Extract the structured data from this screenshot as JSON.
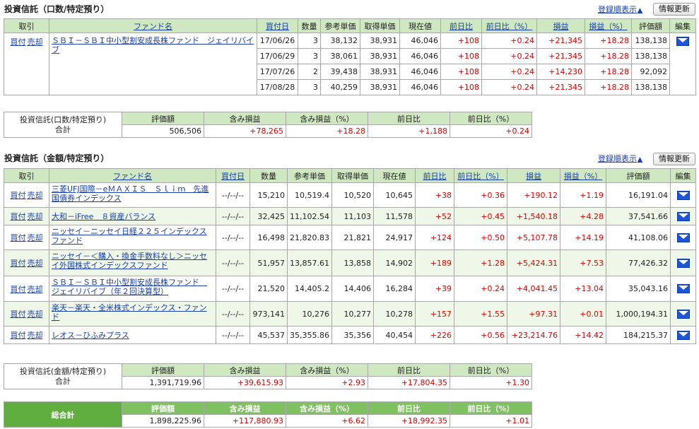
{
  "s1": {
    "title": "投資信託（口数/特定預り）",
    "sort_link": "登録順表示",
    "refresh": "情報更新",
    "headers": [
      "取引",
      "ファンド名",
      "買付日",
      "数量",
      "参考単価",
      "取得単価",
      "現在値",
      "前日比",
      "前日比（%）",
      "損益",
      "損益（%）",
      "評価額",
      "編集"
    ],
    "buy": "買付",
    "sell": "売却",
    "fund": "ＳＢＩ－ＳＢＩ中小型割安成長株ファンド　ジェイリバイブ",
    "rows": [
      [
        "17/06/26",
        "3",
        "38,132",
        "38,931",
        "46,046",
        "+108",
        "+0.24",
        "+21,345",
        "+18.28",
        "138,138"
      ],
      [
        "17/06/29",
        "3",
        "38,061",
        "38,931",
        "46,046",
        "+108",
        "+0.24",
        "+21,345",
        "+18.28",
        "138,138"
      ],
      [
        "17/07/26",
        "2",
        "39,438",
        "38,931",
        "46,046",
        "+108",
        "+0.24",
        "+14,230",
        "+18.28",
        "92,092"
      ],
      [
        "17/08/28",
        "3",
        "40,259",
        "38,931",
        "46,046",
        "+108",
        "+0.24",
        "+21,345",
        "+18.28",
        "138,138"
      ]
    ]
  },
  "sum1": {
    "label1": "投資信託(口数/特定預り)",
    "label2": "合計",
    "headers": [
      "評価額",
      "含み損益",
      "含み損益（%）",
      "前日比",
      "前日比（%）"
    ],
    "values": [
      "506,506",
      "+78,265",
      "+18.28",
      "+1,188",
      "+0.24"
    ]
  },
  "s2": {
    "title": "投資信託（金額/特定預り）",
    "sort_link": "登録順表示",
    "refresh": "情報更新",
    "headers": [
      "取引",
      "ファンド名",
      "買付日",
      "数量",
      "参考単価",
      "取得単価",
      "現在値",
      "前日比",
      "前日比（%）",
      "損益",
      "損益（%）",
      "評価額",
      "編集"
    ],
    "buy": "買付",
    "sell": "売却",
    "rows": [
      [
        "三菱UFJ国際－eＭＡＸＩＳ　Ｓｌｉｍ　先進国債券インデックス",
        "--/--/--",
        "15,210",
        "10,519.4",
        "10,520",
        "10,645",
        "+38",
        "+0.36",
        "+190.12",
        "+1.19",
        "16,191.04"
      ],
      [
        "大和－iFree　８資産バランス",
        "--/--/--",
        "32,425",
        "11,102.54",
        "11,103",
        "11,578",
        "+52",
        "+0.45",
        "+1,540.18",
        "+4.28",
        "37,541.66"
      ],
      [
        "ニッセイ－ニッセイ日経２２５インデックスファンド",
        "--/--/--",
        "16,498",
        "21,820.83",
        "21,821",
        "24,917",
        "+124",
        "+0.50",
        "+5,107.78",
        "+14.19",
        "41,108.06"
      ],
      [
        "ニッセイ－＜購入・換金手数料なし＞ニッセイ外国株式インデックスファンド",
        "--/--/--",
        "51,957",
        "13,857.61",
        "13,858",
        "14,902",
        "+189",
        "+1.28",
        "+5,424.31",
        "+7.53",
        "77,426.32"
      ],
      [
        "ＳＢＩ－ＳＢＩ中小型割安成長株ファンド　ジェイリバイブ（年２回決算型）",
        "--/--/--",
        "21,520",
        "14,405.2",
        "14,406",
        "16,284",
        "+39",
        "+0.24",
        "+4,041.45",
        "+13.04",
        "35,043.16"
      ],
      [
        "楽天－楽天・全米株式インデックス・ファンド",
        "--/--/--",
        "973,141",
        "10,276",
        "10,277",
        "10,278",
        "+157",
        "+1.55",
        "+97.31",
        "+0.01",
        "1,000,194.31"
      ],
      [
        "レオス－ひふみプラス",
        "--/--/--",
        "45,537",
        "35,355.86",
        "35,356",
        "40,454",
        "+226",
        "+0.56",
        "+23,214.76",
        "+14.42",
        "184,215.37"
      ]
    ]
  },
  "sum2": {
    "label1": "投資信託(金額/特定預り)",
    "label2": "合計",
    "headers": [
      "評価額",
      "含み損益",
      "含み損益（%）",
      "前日比",
      "前日比（%）"
    ],
    "values": [
      "1,391,719.96",
      "+39,615.93",
      "+2.93",
      "+17,804.35",
      "+1.30"
    ]
  },
  "total": {
    "label": "総合計",
    "headers": [
      "評価額",
      "含み損益",
      "含み損益（%）",
      "前日比",
      "前日比（%）"
    ],
    "values": [
      "1,898,225.96",
      "+117,880.93",
      "+6.62",
      "+18,992.35",
      "+1.01"
    ]
  },
  "icons": {
    "triangle": "▲",
    "mail": "mail-icon"
  },
  "colors": {
    "header_bg": "#cfe8c1",
    "alt_row": "#eef7e8",
    "positive": "#e00000",
    "total_bg": "#5fae3f",
    "link": "#1a3fa8"
  }
}
